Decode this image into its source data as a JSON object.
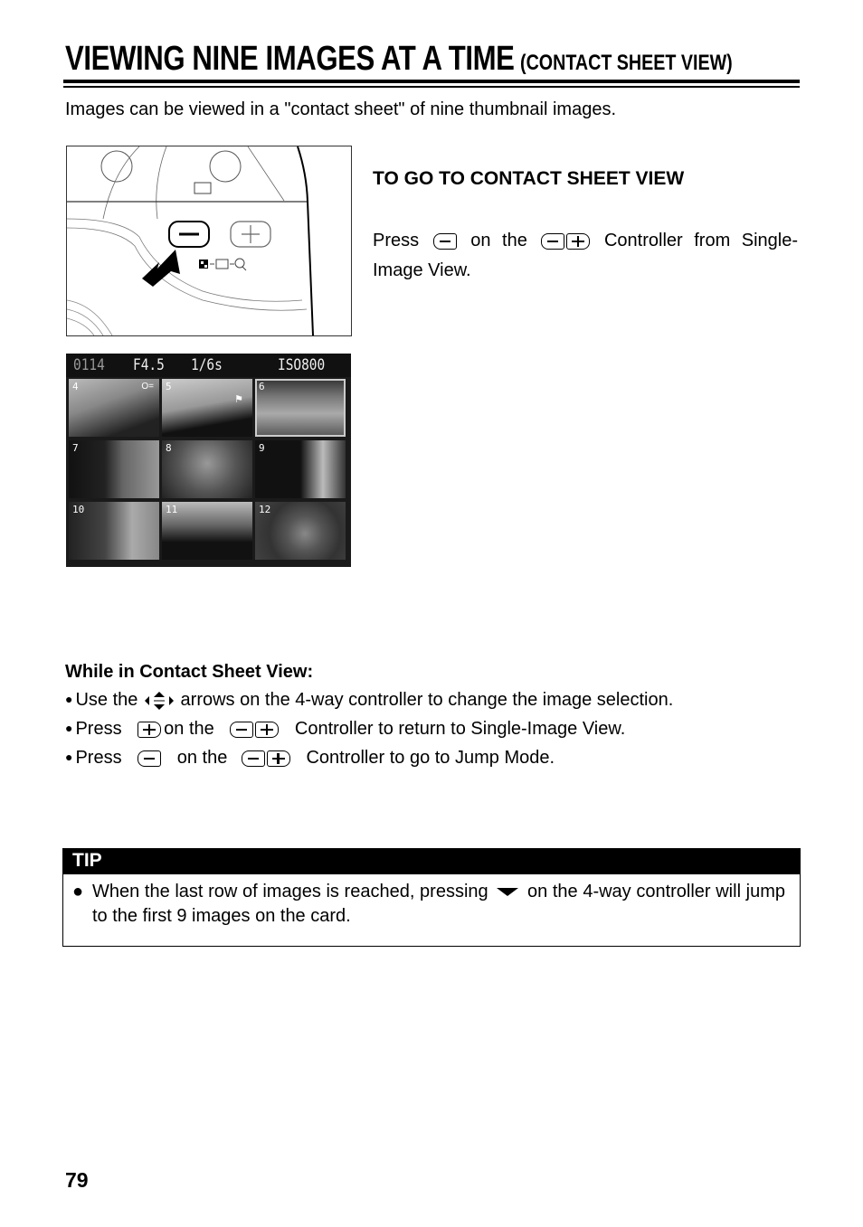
{
  "header": {
    "title": "VIEWING NINE IMAGES AT A TIME",
    "subtitle": "(CONTACT SHEET VIEW)"
  },
  "intro": "Images can be viewed in a \"contact sheet\" of nine thumbnail images.",
  "figure_camera": {
    "description": "Camera back illustration with arrow pointing at minus button",
    "icons": [
      "minus-button",
      "plus-button",
      "contact-sheet-icon",
      "single-image-icon",
      "magnify-icon"
    ]
  },
  "figure_lcd": {
    "file_number": "0114",
    "aperture": "F4.5",
    "shutter": "1/6s",
    "iso": "ISO800",
    "selected_thumbnail": "6",
    "thumbnails": [
      {
        "number": "4",
        "badge": "key-icon"
      },
      {
        "number": "5",
        "badge": "flag-icon"
      },
      {
        "number": "6",
        "badge": ""
      },
      {
        "number": "7",
        "badge": ""
      },
      {
        "number": "8",
        "badge": ""
      },
      {
        "number": "9",
        "badge": ""
      },
      {
        "number": "10",
        "badge": ""
      },
      {
        "number": "11",
        "badge": ""
      },
      {
        "number": "12",
        "badge": ""
      }
    ]
  },
  "go_section": {
    "heading": "TO GO TO CONTACT SHEET VIEW",
    "press": "Press",
    "on_the": "on the",
    "rest": "Controller from Single-Image View."
  },
  "while_section": {
    "heading": "While in Contact Sheet View:",
    "bullets": [
      {
        "pre": "Use the",
        "post": "arrows on the 4-way controller to change the image selection."
      },
      {
        "pre": "Press",
        "mid": "on the",
        "post": "Controller to return to Single-Image View."
      },
      {
        "pre": "Press",
        "mid": "on the",
        "post": "Controller to go to Jump Mode."
      }
    ]
  },
  "tip": {
    "label": "TIP",
    "text_before": "When the last row of images is reached, pressing",
    "text_after": "on the 4-way controller will jump to the first 9 images on the card."
  },
  "page_number": "79"
}
